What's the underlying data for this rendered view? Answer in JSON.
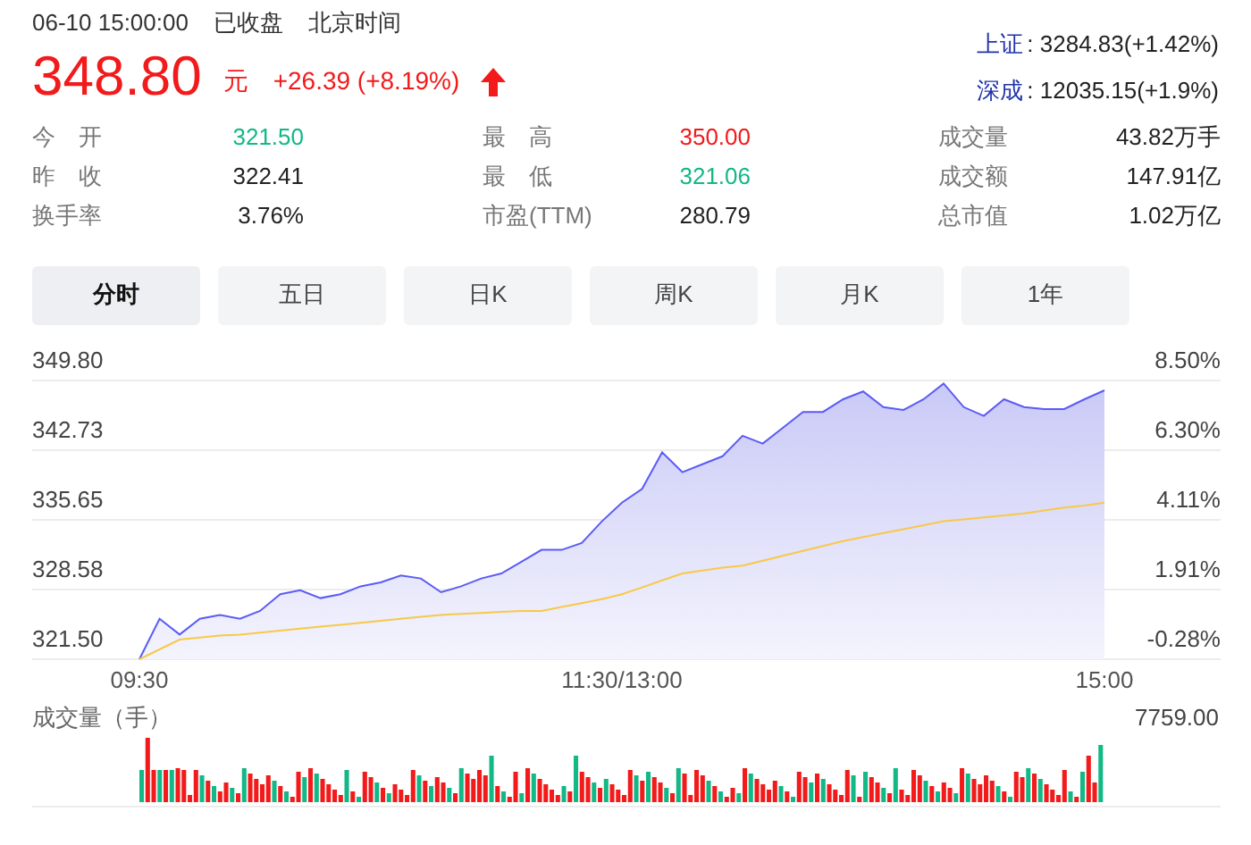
{
  "header": {
    "datetime": "06-10 15:00:00",
    "status": "已收盘",
    "timezone": "北京时间"
  },
  "price": {
    "value": "348.80",
    "unit": "元",
    "change": "+26.39 (+8.19%)",
    "rising": true
  },
  "indices": [
    {
      "name": "上证",
      "value": ": 3284.83(+1.42%)"
    },
    {
      "name": "深成",
      "value": ": 12035.15(+1.9%)"
    }
  ],
  "stats": [
    {
      "label": "今　开",
      "value": "321.50",
      "color": "#12b886"
    },
    {
      "label": "最　高",
      "value": "350.00",
      "color": "#f21a1a"
    },
    {
      "label": "成交量",
      "value": "43.82万手",
      "color": "#222222"
    },
    {
      "label": "昨　收",
      "value": "322.41",
      "color": "#222222"
    },
    {
      "label": "最　低",
      "value": "321.06",
      "color": "#12b886"
    },
    {
      "label": "成交额",
      "value": "147.91亿",
      "color": "#222222"
    },
    {
      "label": "换手率",
      "value": "3.76%",
      "color": "#222222"
    },
    {
      "label": "市盈(TTM)",
      "value": "280.79",
      "color": "#222222"
    },
    {
      "label": "总市值",
      "value": "1.02万亿",
      "color": "#222222"
    }
  ],
  "tabs": [
    {
      "label": "分时",
      "selected": true
    },
    {
      "label": "五日",
      "selected": false
    },
    {
      "label": "日K",
      "selected": false
    },
    {
      "label": "周K",
      "selected": false
    },
    {
      "label": "月K",
      "selected": false
    },
    {
      "label": "1年",
      "selected": false
    }
  ],
  "price_chart": {
    "chart_data": {
      "type": "area",
      "grid": true,
      "categories": [
        "09:30",
        null,
        null,
        null,
        null,
        null,
        null,
        null,
        null,
        null,
        null,
        null,
        null,
        null,
        null,
        null,
        null,
        null,
        null,
        null,
        null,
        null,
        null,
        null,
        "11:30/13:00",
        null,
        null,
        null,
        null,
        null,
        null,
        null,
        null,
        null,
        null,
        null,
        null,
        null,
        null,
        null,
        null,
        null,
        null,
        null,
        null,
        null,
        null,
        null,
        "15:00"
      ],
      "series": [
        {
          "type": "area",
          "color": "#5b5bf5",
          "values": [
            321.5,
            325.6,
            324.0,
            325.6,
            326.0,
            325.6,
            326.4,
            328.1,
            328.5,
            327.7,
            328.1,
            328.9,
            329.3,
            330.0,
            329.7,
            328.3,
            328.9,
            329.7,
            330.2,
            331.4,
            332.6,
            332.6,
            333.3,
            335.5,
            337.4,
            338.8,
            342.5,
            340.5,
            341.3,
            342.1,
            344.2,
            343.4,
            345.0,
            346.6,
            346.6,
            347.9,
            348.7,
            347.1,
            346.8,
            347.9,
            349.5,
            347.1,
            346.2,
            347.9,
            347.1,
            346.9,
            346.9,
            347.9,
            348.8
          ]
        },
        {
          "type": "line",
          "color": "#f7c948",
          "values": [
            321.5,
            322.5,
            323.5,
            323.7,
            323.9,
            324.0,
            324.2,
            324.4,
            324.6,
            324.8,
            325.0,
            325.2,
            325.4,
            325.6,
            325.8,
            326.0,
            326.1,
            326.2,
            326.3,
            326.4,
            326.4,
            326.8,
            327.2,
            327.6,
            328.1,
            328.8,
            329.5,
            330.2,
            330.5,
            330.8,
            331.0,
            331.5,
            332.0,
            332.5,
            333.0,
            333.5,
            333.9,
            334.3,
            334.7,
            335.1,
            335.5,
            335.7,
            335.9,
            336.1,
            336.3,
            336.6,
            336.9,
            337.1,
            337.4
          ]
        }
      ],
      "ylim": [
        321.5,
        349.8
      ],
      "yticks": [
        {
          "value": 349.8,
          "label": "349.80"
        },
        {
          "value": 342.73,
          "label": "342.73"
        },
        {
          "value": 335.65,
          "label": "335.65"
        },
        {
          "value": 328.58,
          "label": "328.58"
        },
        {
          "value": 321.5,
          "label": "321.50"
        }
      ]
    },
    "percent_ticks": [
      "8.50%",
      "6.30%",
      "4.11%",
      "1.91%",
      "-0.28%"
    ]
  },
  "volume": {
    "title": "成交量（手）",
    "max_label": "7759.00"
  }
}
